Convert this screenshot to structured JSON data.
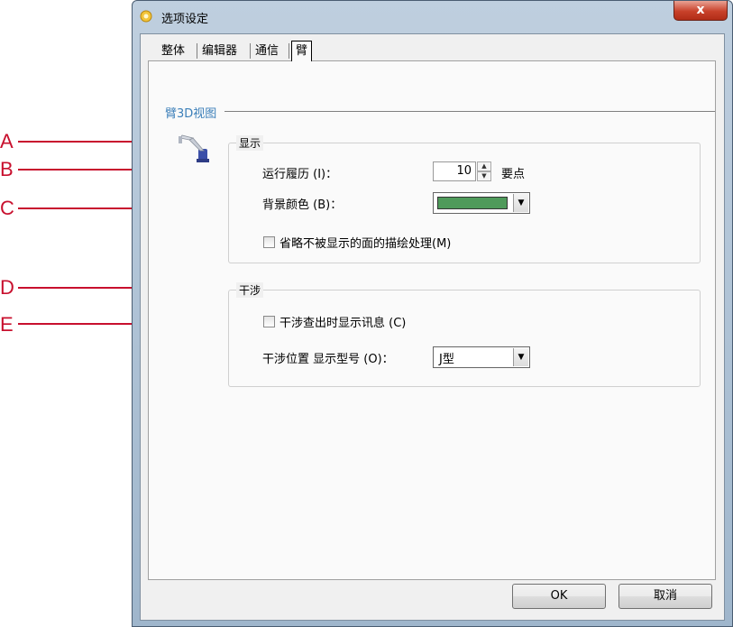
{
  "window": {
    "title": "选项设定",
    "close_label": "x"
  },
  "tabs": [
    {
      "label": "整体"
    },
    {
      "label": "编辑器"
    },
    {
      "label": "通信"
    },
    {
      "label": "臂",
      "selected": true
    }
  ],
  "section": {
    "title": "臂3D视图"
  },
  "display_group": {
    "label": "显示",
    "history_label": "运行履历 (I)：",
    "history_value": "10",
    "history_unit": "要点",
    "bg_color_label": "背景颜色 (B)：",
    "bg_color": "#4f9a5a",
    "omit_checkbox_label": "省略不被显示的面的描绘处理(M)",
    "omit_checked": false
  },
  "interference_group": {
    "label": "干涉",
    "msg_checkbox_label": "干涉查出时显示讯息 (C)",
    "msg_checked": false,
    "type_label": "干涉位置 显示型号 (O)：",
    "type_value": "J型"
  },
  "buttons": {
    "ok": "OK",
    "cancel": "取消"
  },
  "callouts": [
    "A",
    "B",
    "C",
    "D",
    "E"
  ],
  "colors": {
    "callout": "#c8102e",
    "section_title": "#3c7fb9"
  },
  "icons": {
    "app": "gear-icon",
    "robot": "robot-arm-icon",
    "close": "close-icon"
  }
}
